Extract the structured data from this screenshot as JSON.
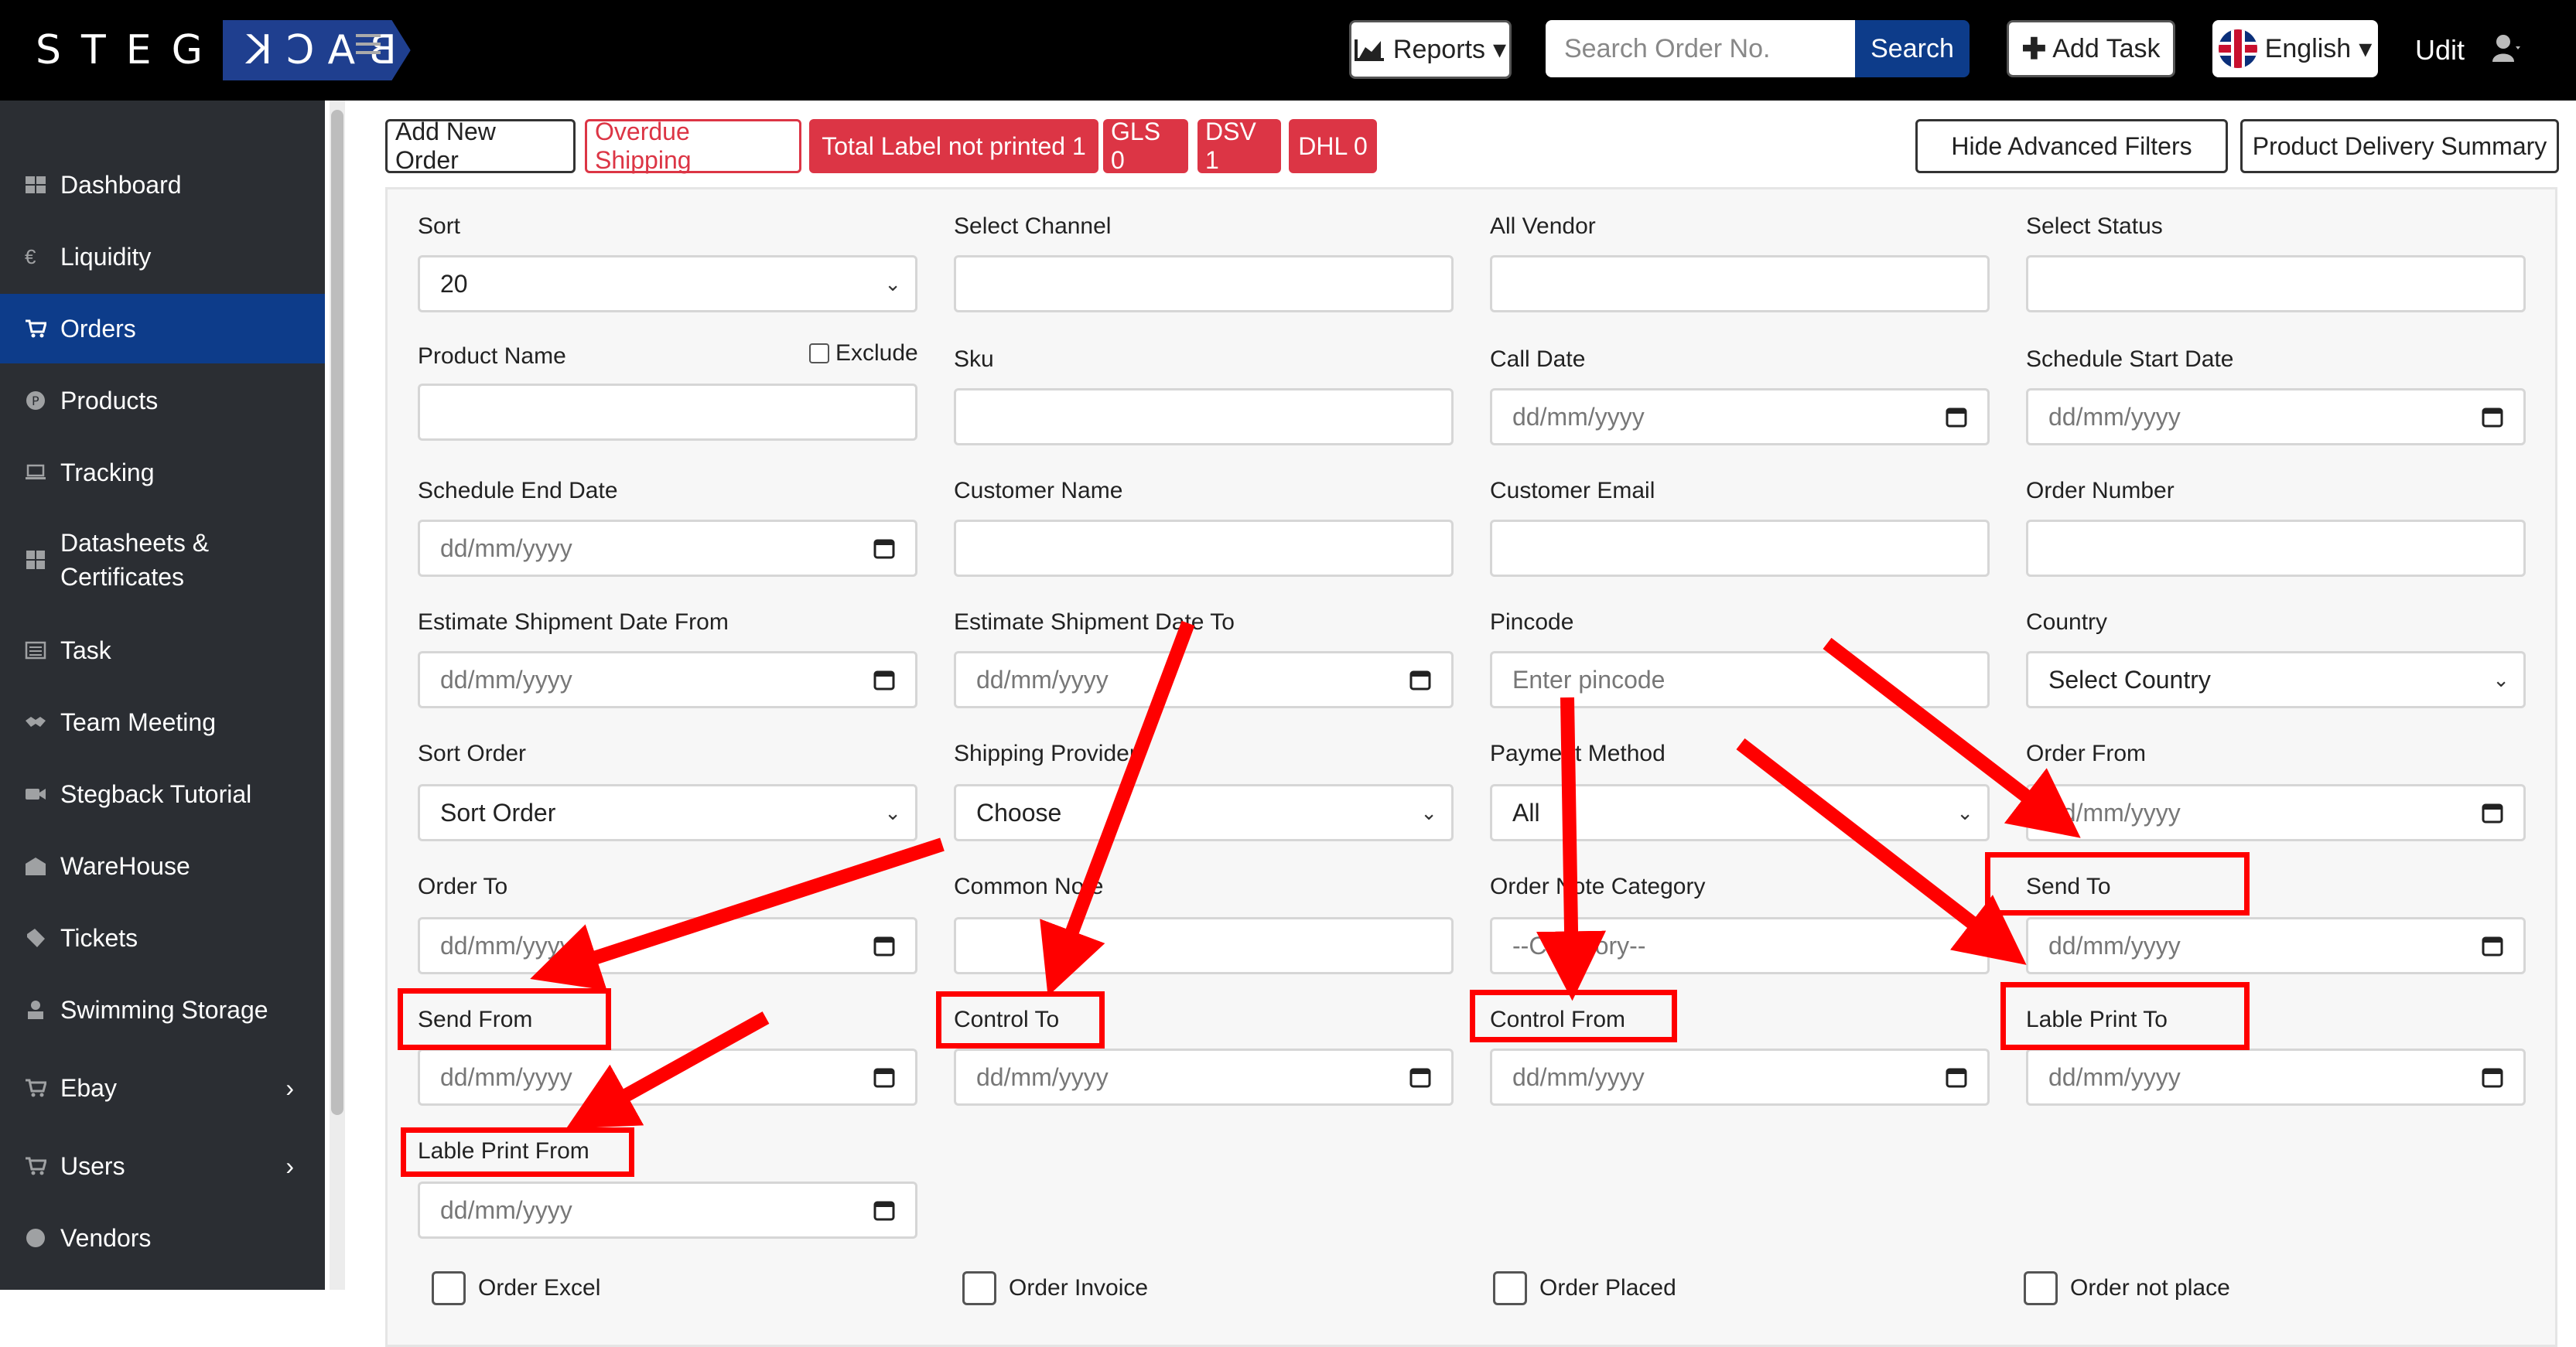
{
  "header": {
    "logo_left": "STEG",
    "logo_right": "BACK",
    "reports_label": "Reports",
    "search_placeholder": "Search Order No.",
    "search_button": "Search",
    "add_task_label": "Add Task",
    "language": "English",
    "user_name": "Udit"
  },
  "sidebar": {
    "items": [
      {
        "label": "Dashboard",
        "icon": "dashboard-icon"
      },
      {
        "label": "Liquidity",
        "icon": "euro-icon"
      },
      {
        "label": "Orders",
        "icon": "cart-icon",
        "active": true
      },
      {
        "label": "Products",
        "icon": "product-icon"
      },
      {
        "label": "Tracking",
        "icon": "laptop-icon"
      },
      {
        "label": "Datasheets &",
        "label2": "Certificates",
        "icon": "grid-icon"
      },
      {
        "label": "Task",
        "icon": "list-icon"
      },
      {
        "label": "Team Meeting",
        "icon": "handshake-icon"
      },
      {
        "label": "Stegback Tutorial",
        "icon": "video-icon"
      },
      {
        "label": "WareHouse",
        "icon": "warehouse-icon"
      },
      {
        "label": "Tickets",
        "icon": "ticket-icon"
      },
      {
        "label": "Swimming Storage",
        "icon": "storage-icon"
      },
      {
        "label": "Ebay",
        "icon": "cart-icon",
        "expand": true
      },
      {
        "label": "Users",
        "icon": "users-icon",
        "expand": true
      },
      {
        "label": "Vendors",
        "icon": "globe-icon"
      }
    ]
  },
  "actions": {
    "add_new_order": "Add New Order",
    "overdue_shipping": "Overdue Shipping",
    "total_label": "Total Label not printed 1",
    "gls": "GLS 0",
    "dsv": "DSV 1",
    "dhl": "DHL 0",
    "hide_filters": "Hide Advanced Filters",
    "delivery_summary": "Product Delivery Summary"
  },
  "filters": {
    "sort": {
      "label": "Sort",
      "value": "20"
    },
    "channel": {
      "label": "Select Channel"
    },
    "vendor": {
      "label": "All Vendor"
    },
    "status": {
      "label": "Select Status"
    },
    "product_name": {
      "label": "Product Name",
      "exclude_label": "Exclude"
    },
    "sku": {
      "label": "Sku"
    },
    "call_date": {
      "label": "Call Date",
      "placeholder": "dd/mm/yyyy"
    },
    "schedule_start": {
      "label": "Schedule Start Date",
      "placeholder": "dd/mm/yyyy"
    },
    "schedule_end": {
      "label": "Schedule End Date",
      "placeholder": "dd/mm/yyyy"
    },
    "customer_name": {
      "label": "Customer Name"
    },
    "customer_email": {
      "label": "Customer Email"
    },
    "order_number": {
      "label": "Order Number"
    },
    "est_from": {
      "label": "Estimate Shipment Date From",
      "placeholder": "dd/mm/yyyy"
    },
    "est_to": {
      "label": "Estimate Shipment Date To",
      "placeholder": "dd/mm/yyyy"
    },
    "pincode": {
      "label": "Pincode",
      "placeholder": "Enter pincode"
    },
    "country": {
      "label": "Country",
      "value": "Select Country"
    },
    "sort_order": {
      "label": "Sort Order",
      "value": "Sort Order"
    },
    "shipping_provider": {
      "label": "Shipping Provider",
      "value": "Choose"
    },
    "payment_method": {
      "label": "Payment Method",
      "value": "All"
    },
    "order_from": {
      "label": "Order From",
      "placeholder": "dd/mm/yyyy"
    },
    "order_to": {
      "label": "Order To",
      "placeholder": "dd/mm/yyyy"
    },
    "common_note": {
      "label": "Common Note"
    },
    "note_category": {
      "label": "Order Note Category",
      "value": "--Category--"
    },
    "send_to": {
      "label": "Send To",
      "placeholder": "dd/mm/yyyy"
    },
    "send_from": {
      "label": "Send From",
      "placeholder": "dd/mm/yyyy"
    },
    "control_to": {
      "label": "Control To",
      "placeholder": "dd/mm/yyyy"
    },
    "control_from": {
      "label": "Control From",
      "placeholder": "dd/mm/yyyy"
    },
    "label_print_to": {
      "label": "Lable Print To",
      "placeholder": "dd/mm/yyyy"
    },
    "label_print_from": {
      "label": "Lable Print From",
      "placeholder": "dd/mm/yyyy"
    }
  },
  "checkboxes": {
    "order_excel": "Order Excel",
    "order_invoice": "Order Invoice",
    "order_placed": "Order Placed",
    "order_not_placed": "Order not place"
  },
  "annotation": {
    "color": "#ff0000"
  }
}
